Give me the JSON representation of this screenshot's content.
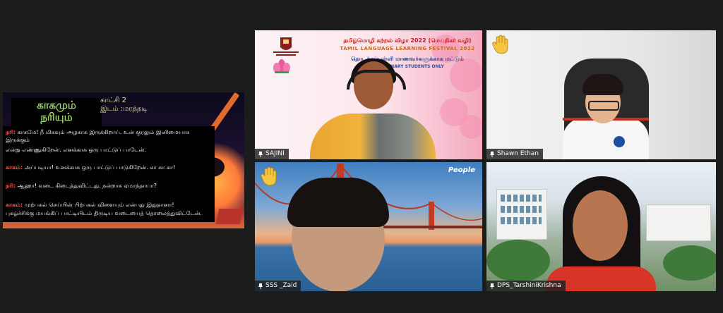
{
  "slide": {
    "title_line1": "காகமும்",
    "title_line2": "நரியும்",
    "scene": "காட்சி 2",
    "place": "இடம் :மரத்தடி",
    "lines": [
      {
        "speaker": "நரி:",
        "text": " காகமே! நீ மிகவும் அழகாக இருக்கிறாய். உன் குரலும் இனிமையாக"
      },
      {
        "speaker": "",
        "text": "இருக்கும்"
      },
      {
        "speaker": "",
        "text": "என்று எண்ணுகிறேன். எனக்காக ஒரு பாட்டுப் பாடேன்."
      },
      {
        "speaker": "காகம்:",
        "text": " அப்படியா! உனக்காக ஒரு பாட்டுப் பாடுகிறேன். கா கா கா!"
      },
      {
        "speaker": "நரி:",
        "text": " ஆஹா! வடை கிடைத்துவிட்டது. நன்றாக ஏமாந்தாயா?"
      },
      {
        "speaker": "காகம்:",
        "text": " முற்பகல் செய்யின் பிற்பகல் விளையும் என்பது இதுதானா!"
      },
      {
        "speaker": "",
        "text": "புகழ்ச்சிக்கு மயங்கிப் பாட்டியிடம் திருடிய வடையைத் தொலைத்துவிட்டேன்."
      }
    ]
  },
  "tiles": [
    {
      "name": "SAJINI",
      "banner": {
        "line1": "தமிழ்மொழி கற்றல் விழா 2022 (மெய்நிகர் வழி)",
        "line2": "TAMIL LANGUAGE LEARNING FESTIVAL 2022",
        "line3": "தொடக்கப்பள்ளி மாணவர்களுக்காக மட்டும்",
        "line4": "FOR PRIMARY STUDENTS ONLY"
      }
    },
    {
      "name": "Shawn Ethan",
      "hand_raised": true
    },
    {
      "name": "SSS _Zaid",
      "hand_raised": true,
      "overlay_logo": "People"
    },
    {
      "name": "DPS_TarshiniKrishna"
    }
  ],
  "colors": {
    "active_speaker_border": "#d7e85a",
    "background": "#1c1c1c"
  }
}
